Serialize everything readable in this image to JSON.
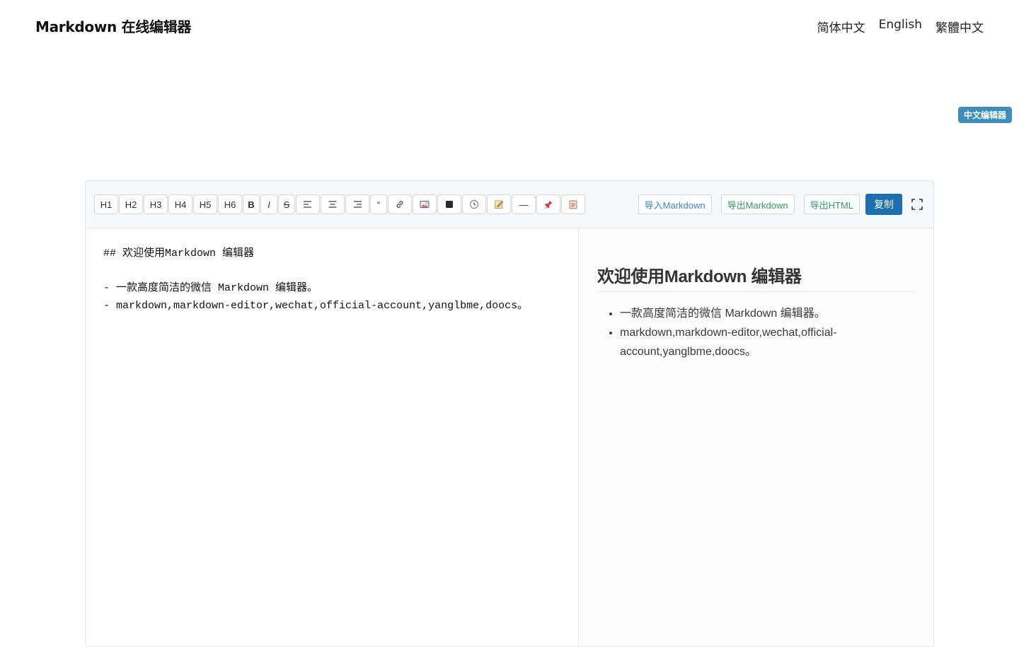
{
  "header": {
    "title": "Markdown 在线编辑器",
    "languages": [
      "简体中文",
      "English",
      "繁體中文"
    ]
  },
  "side_badge": "中文编辑器",
  "toolbar": {
    "headings": [
      "H1",
      "H2",
      "H3",
      "H4",
      "H5",
      "H6"
    ],
    "bold": "B",
    "italic": "I",
    "strike": "S",
    "quote": "“",
    "hr": "—",
    "icons": [
      "align-left-icon",
      "align-center-icon",
      "align-right-icon",
      "quote-icon",
      "link-icon",
      "image-icon",
      "code-block-icon",
      "clock-icon",
      "note-icon",
      "horizontal-rule-icon",
      "pin-icon",
      "clipboard-icon"
    ],
    "import_label": "导入Markdown",
    "export_label": "导出Markdown",
    "export_html_label": "导出HTML",
    "copy_label": "复制"
  },
  "source": {
    "lines": [
      "## 欢迎使用Markdown 编辑器",
      "",
      "- 一款高度简洁的微信 Markdown 编辑器。",
      "- markdown,markdown-editor,wechat,official-account,yanglbme,doocs。"
    ]
  },
  "preview": {
    "heading": "欢迎使用Markdown 编辑器",
    "items": [
      "一款高度简洁的微信 Markdown 编辑器。",
      "markdown,markdown-editor,wechat,official-account,yanglbme,doocs。"
    ]
  },
  "colors": {
    "accent": "#1a6fb0",
    "badge": "#3d8dbd",
    "export_green": "#2f9e5a",
    "import_blue": "#3a87c4"
  }
}
